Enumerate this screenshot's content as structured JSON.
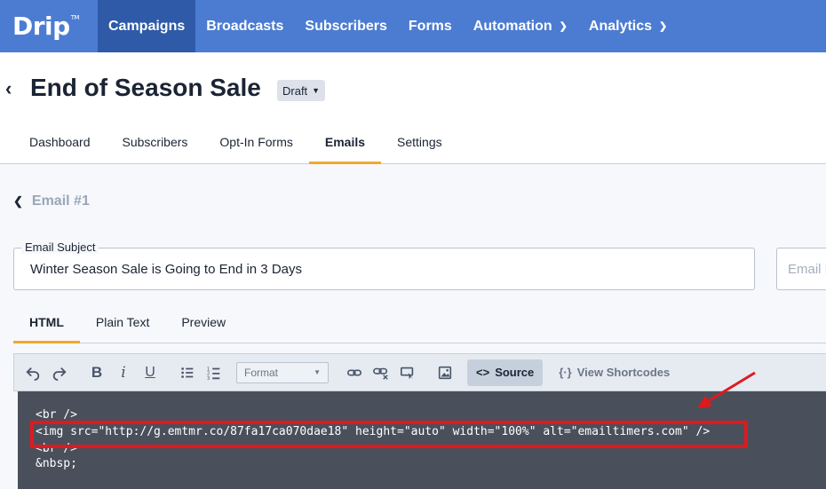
{
  "app": {
    "logo": "Drip",
    "logo_tm": "TM"
  },
  "topnav": {
    "items": [
      {
        "label": "Campaigns",
        "active": true
      },
      {
        "label": "Broadcasts"
      },
      {
        "label": "Subscribers"
      },
      {
        "label": "Forms"
      },
      {
        "label": "Automation",
        "has_dropdown": true
      },
      {
        "label": "Analytics",
        "has_dropdown": true
      }
    ]
  },
  "header": {
    "title": "End of Season Sale",
    "status": "Draft",
    "tabs": [
      {
        "label": "Dashboard"
      },
      {
        "label": "Subscribers"
      },
      {
        "label": "Opt-In Forms"
      },
      {
        "label": "Emails",
        "active": true
      },
      {
        "label": "Settings"
      }
    ]
  },
  "email": {
    "back_label": "Email #1",
    "subject_label": "Email Subject",
    "subject_value": "Winter Season Sale is Going to End in 3 Days",
    "from_name_placeholder": "Email F"
  },
  "editor": {
    "tabs": [
      {
        "label": "HTML",
        "active": true
      },
      {
        "label": "Plain Text"
      },
      {
        "label": "Preview"
      }
    ],
    "toolbar": {
      "format_placeholder": "Format",
      "source_label": "Source",
      "shortcodes_label": "View Shortcodes"
    },
    "code_lines": [
      "<br />",
      "<img src=\"http://g.emtmr.co/87fa17ca070dae18\" height=\"auto\" width=\"100%\" alt=\"emailtimers.com\" />",
      "<br />",
      "&nbsp;"
    ]
  },
  "colors": {
    "nav_bg": "#4c7cd1",
    "nav_active": "#2e5aa8",
    "tab_underline": "#f0a830",
    "highlight": "#e0191f"
  }
}
